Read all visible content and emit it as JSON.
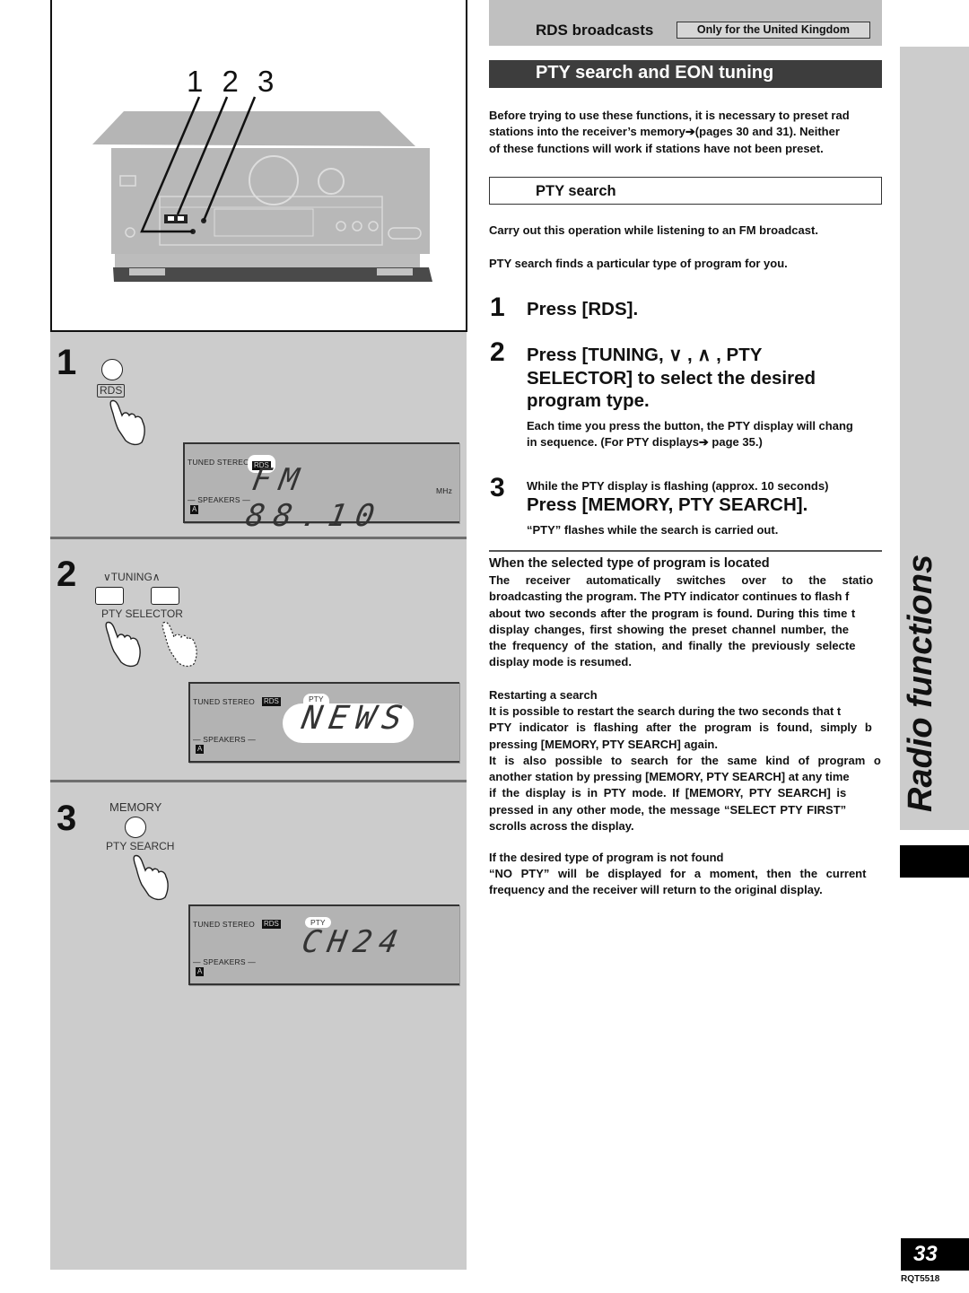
{
  "header": {
    "section_label": "RDS broadcasts",
    "region_badge": "Only for the United Kingdom",
    "title": "PTY search and EON tuning"
  },
  "intro": {
    "lines": [
      "Before trying to use these functions, it is necessary to preset rad",
      "stations into the receiver’s memory➔(pages 30 and 31). Neither",
      "of  these functions will work if stations have not been preset."
    ]
  },
  "pty_search": {
    "title": "PTY search",
    "note1": "Carry out this operation while listening to an FM broadcast.",
    "note2": "PTY search finds a particular type of program for you."
  },
  "steps": [
    {
      "num": "1",
      "heading": [
        "Press [RDS]."
      ]
    },
    {
      "num": "2",
      "heading": [
        "Press [TUNING,  ∨ ,  ∧ , PTY",
        "SELECTOR] to select the desired",
        "program type."
      ],
      "detail": [
        "Each time you press the button, the PTY display will chang",
        "in sequence. (For PTY displays➔ page 35.)"
      ]
    },
    {
      "num": "3",
      "pre": "While the PTY display is flashing (approx. 10 seconds)",
      "heading": [
        "Press [MEMORY, PTY SEARCH]."
      ],
      "detail": [
        "“PTY” flashes while the search is carried out."
      ]
    }
  ],
  "located": {
    "title": "When the selected type of program is located",
    "lines": [
      "The receiver automatically switches over to the statio",
      "broadcasting the program. The PTY indicator continues to flash f",
      "about two seconds after the program is found. During this time t",
      "display changes, first showing the preset channel number, the",
      "the frequency of the station, and finally the previously selecte",
      "display mode is  resumed."
    ]
  },
  "restart": {
    "title": "Restarting a search",
    "lines": [
      "It is possible to restart the search during the two seconds that t",
      "PTY indicator is flashing after the program is found, simply b",
      "pressing [MEMORY, PTY SEARCH] again.",
      "It is also possible to search for the same kind of program o",
      "another station by pressing [MEMORY, PTY SEARCH] at any time",
      "if the display is in PTY mode. If  [MEMORY, PTY SEARCH] is",
      "pressed in any other mode, the message “SELECT PTY FIRST”",
      "scrolls across the display."
    ]
  },
  "not_found": {
    "title": "If the desired type of program is not found",
    "lines": [
      "“NO PTY” will be displayed for a moment, then the current",
      "frequency and the receiver will return to the original display."
    ]
  },
  "sidebar": {
    "label": "Radio functions"
  },
  "footer": {
    "page_number": "33",
    "doc_code": "RQT5518"
  },
  "illustration": {
    "callouts": "1 2 3",
    "panel1": {
      "num": "1",
      "button_label": "RDS",
      "lcd": {
        "tuned_stereo": "TUNED  STEREO",
        "rds_tag": "RDS",
        "main": "FM 88.10",
        "unit": "MHz",
        "speakers": "— SPEAKERS —",
        "spk_tag": "A"
      }
    },
    "panel2": {
      "num": "2",
      "tuning_label": "∨TUNING∧",
      "selector_label": "PTY SELECTOR",
      "lcd": {
        "tuned_stereo": "TUNED  STEREO",
        "rds_tag": "RDS",
        "pty_tag": "PTY",
        "main": "NEWS",
        "speakers": "— SPEAKERS —",
        "spk_tag": "A"
      }
    },
    "panel3": {
      "num": "3",
      "memory_label": "MEMORY",
      "search_label": "PTY SEARCH",
      "lcd": {
        "tuned_stereo": "TUNED  STEREO",
        "rds_tag": "RDS",
        "pty_tag": "PTY",
        "main": "CH24",
        "speakers": "— SPEAKERS —",
        "spk_tag": "A"
      }
    }
  }
}
